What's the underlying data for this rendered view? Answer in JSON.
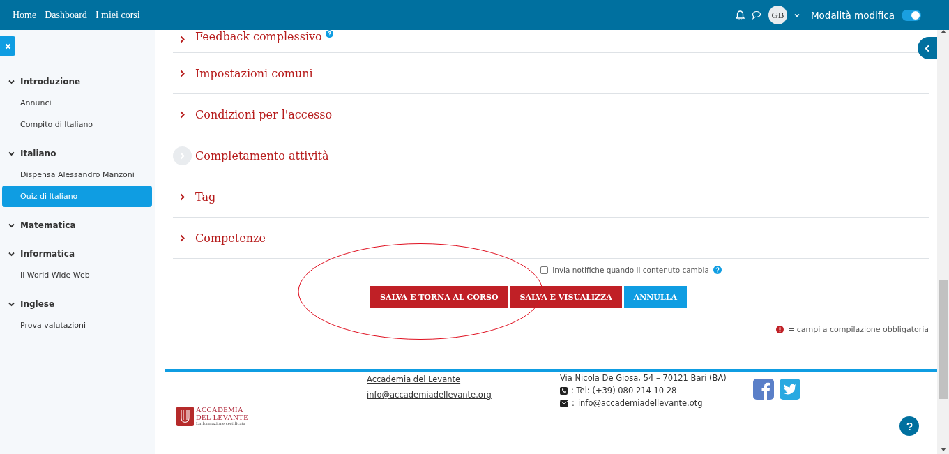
{
  "navbar": {
    "links": [
      "Home",
      "Dashboard",
      "I miei corsi"
    ],
    "avatar_initials": "GB",
    "edit_mode": {
      "label": "Modalità modifica",
      "on": true
    }
  },
  "sidebar": {
    "sections": [
      {
        "title": "Introduzione",
        "expanded": true,
        "items": [
          {
            "label": "Annunci",
            "selected": false
          },
          {
            "label": "Compito di Italiano",
            "selected": false
          }
        ]
      },
      {
        "title": "Italiano",
        "expanded": true,
        "items": [
          {
            "label": "Dispensa Alessandro Manzoni",
            "selected": false
          },
          {
            "label": "Quiz di Italiano",
            "selected": true
          }
        ]
      },
      {
        "title": "Matematica",
        "expanded": true
      },
      {
        "title": "Informatica",
        "expanded": true,
        "items": [
          {
            "label": "Il World Wide Web",
            "selected": false
          }
        ]
      },
      {
        "title": "Inglese",
        "expanded": true,
        "items": [
          {
            "label": "Prova valutazioni",
            "selected": false
          }
        ]
      }
    ]
  },
  "form_sections": [
    {
      "title": "Feedback complessivo",
      "help": true,
      "hovered": false
    },
    {
      "title": "Impostazioni comuni",
      "help": false,
      "hovered": false
    },
    {
      "title": "Condizioni per l'accesso",
      "help": false,
      "hovered": false
    },
    {
      "title": "Completamento attività",
      "help": false,
      "hovered": true
    },
    {
      "title": "Tag",
      "help": false,
      "hovered": false
    },
    {
      "title": "Competenze",
      "help": false,
      "hovered": false
    }
  ],
  "notify_checkbox": {
    "label": "Invia notifiche quando il contenuto cambia",
    "checked": false
  },
  "buttons": [
    {
      "label": "SALVA E TORNA AL CORSO",
      "kind": "primary"
    },
    {
      "label": "SALVA E VISUALIZZA",
      "kind": "primary"
    },
    {
      "label": "ANNULLA",
      "kind": "secondary"
    }
  ],
  "required_note": "= campi a compilazione obbligatoria",
  "footer": {
    "logo": {
      "line1": "ACCADEMIA",
      "line2": "DEL LEVANTE",
      "tagline": "La formazione certificata"
    },
    "links": [
      "Accademia del Levante",
      "info@accademiadellevante.org"
    ],
    "address": "Via Nicola De Giosa, 54 – 70121 Bari (BA)",
    "phone": ": Tel: (+39) 080 214 10 28",
    "email_prefix": ":",
    "email": "info@accademiadellevante.otg"
  }
}
